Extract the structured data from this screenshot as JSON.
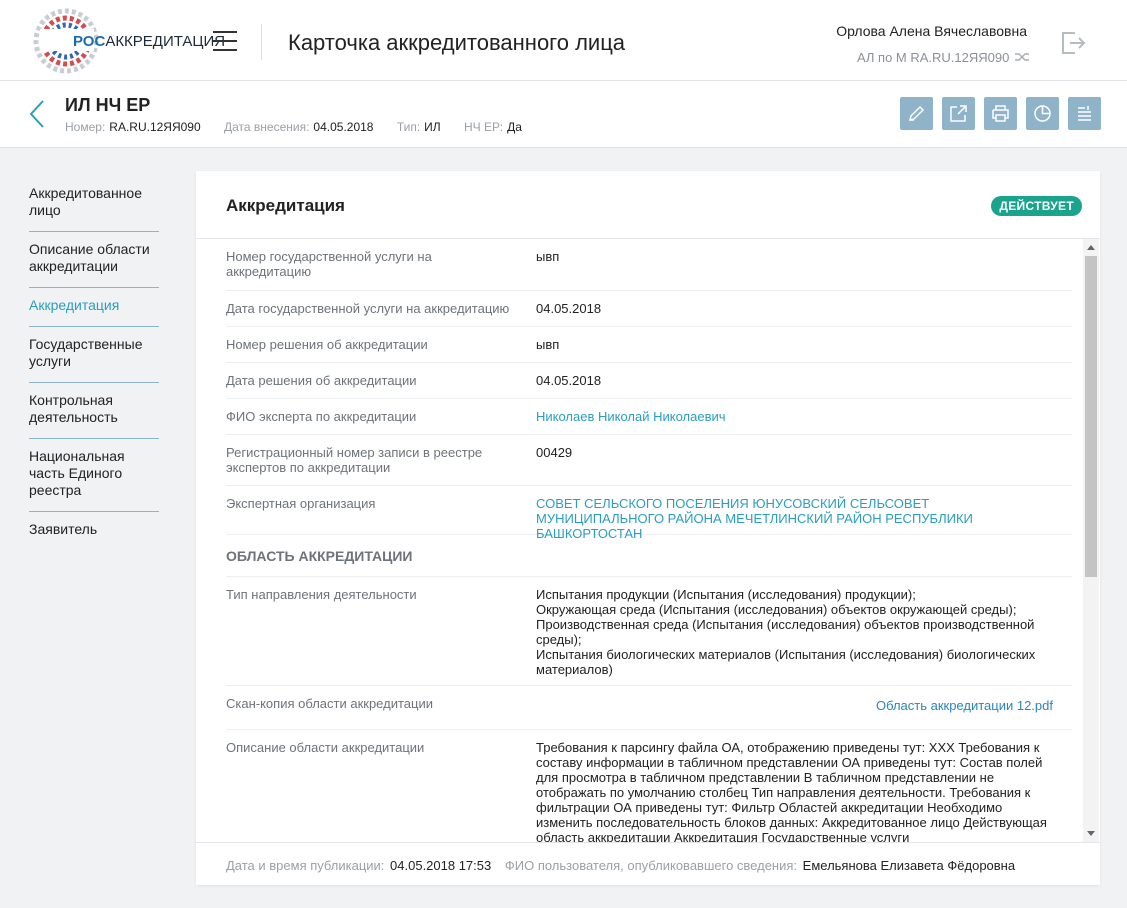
{
  "header": {
    "logo_ros": "РОС",
    "logo_rest": "АККРЕДИТАЦИЯ",
    "page_title": "Карточка аккредитованного лица",
    "user_name": "Орлова Алена Вячеславовна",
    "user_role": "АЛ по М RA.RU.12ЯЯ090"
  },
  "entity": {
    "title": "ИЛ НЧ ЕР",
    "number_label": "Номер:",
    "number": "RA.RU.12ЯЯ090",
    "date_label": "Дата внесения:",
    "date": "04.05.2018",
    "type_label": "Тип:",
    "type": "ИЛ",
    "ncher_label": "НЧ ЕР:",
    "ncher": "Да"
  },
  "toolbar": [
    "pencil-icon",
    "external-link-icon",
    "printer-icon",
    "pie-chart-icon",
    "list-icon"
  ],
  "sidebar": {
    "items": [
      {
        "label": "Аккредитованное лицо"
      },
      {
        "label": "Описание области аккредитации"
      },
      {
        "label": "Аккредитация"
      },
      {
        "label": "Государственные услуги"
      },
      {
        "label": "Контрольная деятельность"
      },
      {
        "label": "Национальная часть Единого реестра"
      },
      {
        "label": "Заявитель"
      }
    ],
    "active_index": 2
  },
  "card": {
    "title": "Аккредитация",
    "status": "ДЕЙСТВУЕТ",
    "status_color": "#1aa48e",
    "rows": [
      {
        "label": "Номер государственной услуги на аккредитацию",
        "value": "ывп"
      },
      {
        "label": "Дата государственной услуги на аккредитацию",
        "value": "04.05.2018"
      },
      {
        "label": "Номер решения об аккредитации",
        "value": "ывп"
      },
      {
        "label": "Дата решения об аккредитации",
        "value": "04.05.2018"
      },
      {
        "label": "ФИО эксперта по аккредитации",
        "value": "Николаев Николай Николаевич"
      },
      {
        "label": "Регистрационный номер записи в реестре экспертов по аккредитации",
        "value": "00429"
      },
      {
        "label": "Экспертная организация",
        "value": "СОВЕТ СЕЛЬСКОГО ПОСЕЛЕНИЯ ЮНУСОВСКИЙ СЕЛЬСОВЕТ МУНИЦИПАЛЬНОГО РАЙОНА МЕЧЕТЛИНСКИЙ РАЙОН РЕСПУБЛИКИ БАШКОРТОСТАН"
      }
    ],
    "section_title": "ОБЛАСТЬ АККРЕДИТАЦИИ",
    "section_rows": [
      {
        "label": "Тип направления деятельности",
        "value": "Испытания продукции (Испытания (исследования) продукции);\nОкружающая среда (Испытания (исследования) объектов окружающей среды);\nПроизводственная среда (Испытания (исследования) объектов производственной среды);\nИспытания биологических материалов (Испытания (исследования) биологических материалов)"
      },
      {
        "label": "Скан-копия области аккредитации",
        "value": "Область аккредитации 12.pdf"
      },
      {
        "label": "Описание области аккредитации",
        "value": "Требования к парсингу файла ОА, отображению приведены тут: ХХХ Требования к составу информации в табличном представлении ОА приведены тут: Состав полей для просмотра в табличном представлении В табличном представлении не отображать по умолчанию столбец Тип направления деятельности. Требования к фильтрации ОА приведены тут: Фильтр Областей аккредитации Необходимо изменить последовательность блоков данных: Аккредитованное лицо Действующая область аккредитации Аккредитация Государственные услуги"
      }
    ],
    "footer": {
      "pub_label": "Дата и время публикации:",
      "pub_value": "04.05.2018 17:53",
      "user_label": "ФИО пользователя, опубликовавшего сведения:",
      "user_value": "Емельянова Елизавета Фёдоровна"
    }
  }
}
